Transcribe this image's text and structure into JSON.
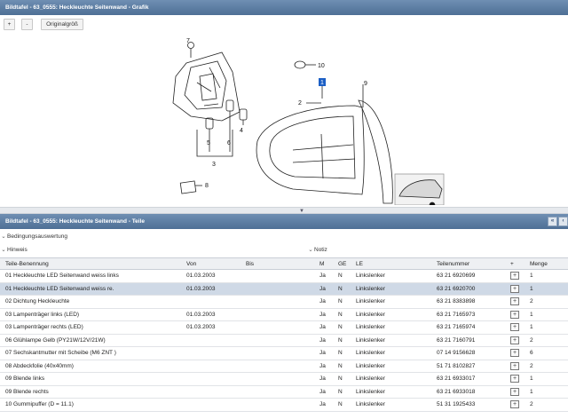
{
  "graphic_panel": {
    "title": "Bildtafel - 63_0555: Heckleuchte Seitenwand - Grafik",
    "zoom_in_label": "+",
    "zoom_out_label": "-",
    "original_size_label": "Originalgröß",
    "callouts": [
      "7",
      "10",
      "1",
      "2",
      "9",
      "5",
      "6",
      "4",
      "3",
      "8"
    ]
  },
  "parts_panel": {
    "title": "Bildtafel - 63_0555: Heckleuchte Seitenwand - Teile",
    "collapse_left": "«",
    "collapse_right": "‹",
    "conditions_label": "Bedingungsauswertung",
    "hint_label": "Hinweis",
    "note_label": "Notiz",
    "columns": [
      "Teile-Benennung",
      "Von",
      "Bis",
      "M",
      "GE",
      "LE",
      "Teilenummer",
      "+",
      "Menge"
    ],
    "rows": [
      {
        "name": "01 Heckleuchte LED Seitenwand weiss links",
        "von": "01.03.2003",
        "bis": "",
        "m": "Ja",
        "ge": "N",
        "le": "Linkslenker",
        "nr": "63 21 6920699",
        "qty": "1"
      },
      {
        "name": "01 Heckleuchte LED Seitenwand weiss re.",
        "von": "01.03.2003",
        "bis": "",
        "m": "Ja",
        "ge": "N",
        "le": "Linkslenker",
        "nr": "63 21 6920700",
        "qty": "1"
      },
      {
        "name": "02 Dichtung Heckleuchte",
        "von": "",
        "bis": "",
        "m": "Ja",
        "ge": "N",
        "le": "Linkslenker",
        "nr": "63 21 8383898",
        "qty": "2"
      },
      {
        "name": "03 Lampenträger links (LED)",
        "von": "01.03.2003",
        "bis": "",
        "m": "Ja",
        "ge": "N",
        "le": "Linkslenker",
        "nr": "63 21 7165973",
        "qty": "1"
      },
      {
        "name": "03 Lampenträger rechts (LED)",
        "von": "01.03.2003",
        "bis": "",
        "m": "Ja",
        "ge": "N",
        "le": "Linkslenker",
        "nr": "63 21 7165974",
        "qty": "1"
      },
      {
        "name": "06 Glühlampe Gelb (PY21W/12V/21W)",
        "von": "",
        "bis": "",
        "m": "Ja",
        "ge": "N",
        "le": "Linkslenker",
        "nr": "63 21 7160791",
        "qty": "2"
      },
      {
        "name": "07 Sechskantmutter mit Scheibe (M6 ZNT )",
        "von": "",
        "bis": "",
        "m": "Ja",
        "ge": "N",
        "le": "Linkslenker",
        "nr": "07 14 9156628",
        "qty": "6"
      },
      {
        "name": "08 Abdeckfolie (40x40mm)",
        "von": "",
        "bis": "",
        "m": "Ja",
        "ge": "N",
        "le": "Linkslenker",
        "nr": "51 71 8102827",
        "qty": "2"
      },
      {
        "name": "09 Blende links",
        "von": "",
        "bis": "",
        "m": "Ja",
        "ge": "N",
        "le": "Linkslenker",
        "nr": "63 21 6933017",
        "qty": "1"
      },
      {
        "name": "09 Blende rechts",
        "von": "",
        "bis": "",
        "m": "Ja",
        "ge": "N",
        "le": "Linkslenker",
        "nr": "63 21 6933018",
        "qty": "1"
      },
      {
        "name": "10 Gummipuffer (D = 11.1)",
        "von": "",
        "bis": "",
        "m": "Ja",
        "ge": "N",
        "le": "Linkslenker",
        "nr": "51 31 1925433",
        "qty": "2"
      }
    ]
  },
  "colors": {
    "header": "#56779c",
    "selected_row": "#cfd9e6"
  }
}
